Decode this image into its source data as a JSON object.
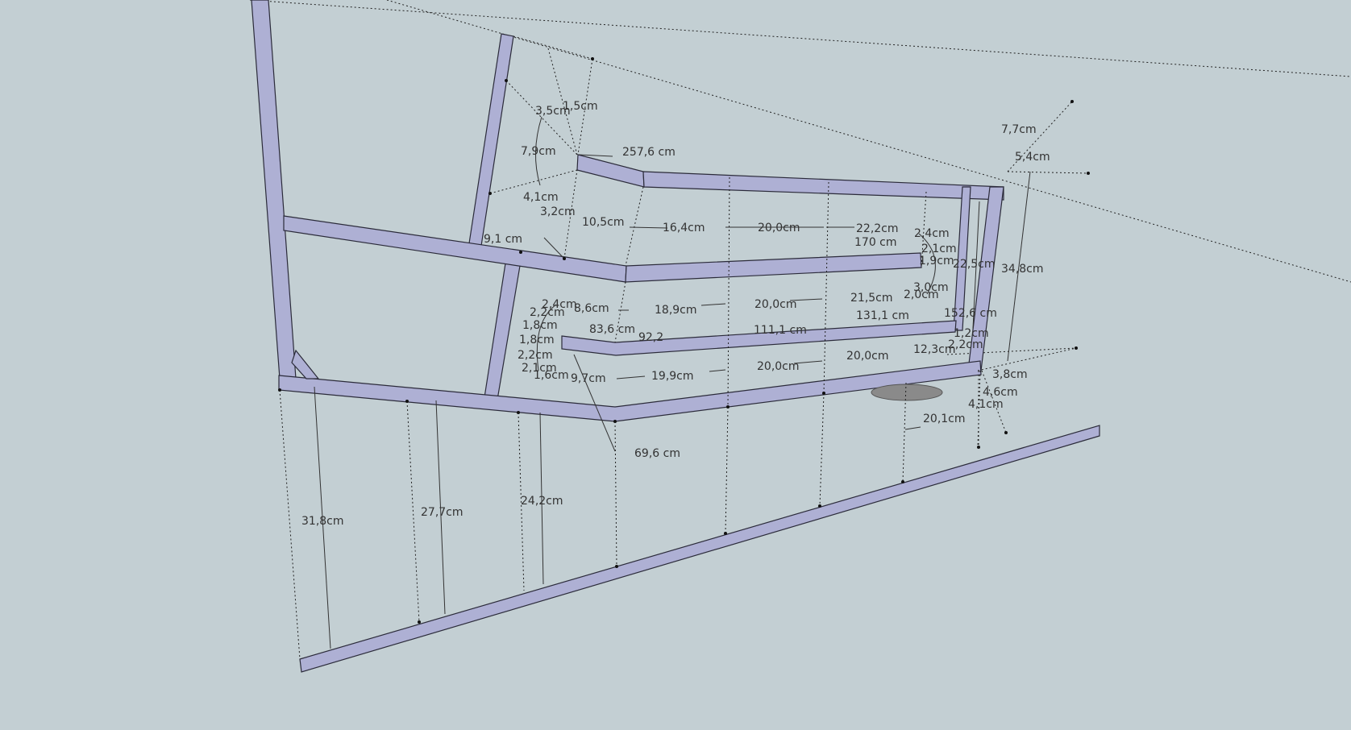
{
  "labels": {
    "d_257_6": "257,6 cm",
    "d_3_5": "3,5cm",
    "d_1_5": "1,5cm",
    "d_7_9": "7,9cm",
    "d_4_1": "4,1cm",
    "d_3_2": "3,2cm",
    "d_10_5": "10,5cm",
    "d_16_4": "16,4cm",
    "d_20_0_top": "20,0cm",
    "d_22_2": "22,2cm",
    "d_9_1": "9,1 cm",
    "d_170": "170 cm",
    "d_22_5": "22,5cm",
    "d_34_8": "34,8cm",
    "d_7_7": "7,7cm",
    "d_5_4": "5,4cm",
    "d_2_4": "2,4cm",
    "d_8_6": "8,6cm",
    "d_18_9": "18,9cm",
    "d_20_0_mid": "20,0cm",
    "d_21_5": "21,5cm",
    "d_2_0": "2,0cm",
    "d_83_6": "83,6 cm",
    "d_92_2": "92,2",
    "d_111_1": "111,1 cm",
    "d_131_1": "131,1 cm",
    "d_152_6": "152,6 cm",
    "d_2_2a": "2,2cm",
    "d_1_8a": "1,8cm",
    "d_1_8b": "1,8cm",
    "d_2_2b": "2,2cm",
    "d_2_1": "2,1cm",
    "d_1_6": "1,6cm",
    "d_9_7": "9,7cm",
    "d_19_9": "19,9cm",
    "d_20_0_low": "20,0cm",
    "d_20_0_low2": "20,0cm",
    "d_12_3": "12,3cm",
    "d_3_8": "3,8cm",
    "d_4_6": "4,6cm",
    "d_4_1b": "4,1cm",
    "d_20_1": "20,1cm",
    "d_69_6": "69,6 cm",
    "d_31_8": "31,8cm",
    "d_27_7": "27,7cm",
    "d_24_2": "24,2cm",
    "d_1_9": "1,9cm",
    "d_2_1b": "2,1cm",
    "d_3_0": "3,0cm",
    "d_1_2": "1,2cm",
    "d_2_2c": "2,2cm"
  }
}
